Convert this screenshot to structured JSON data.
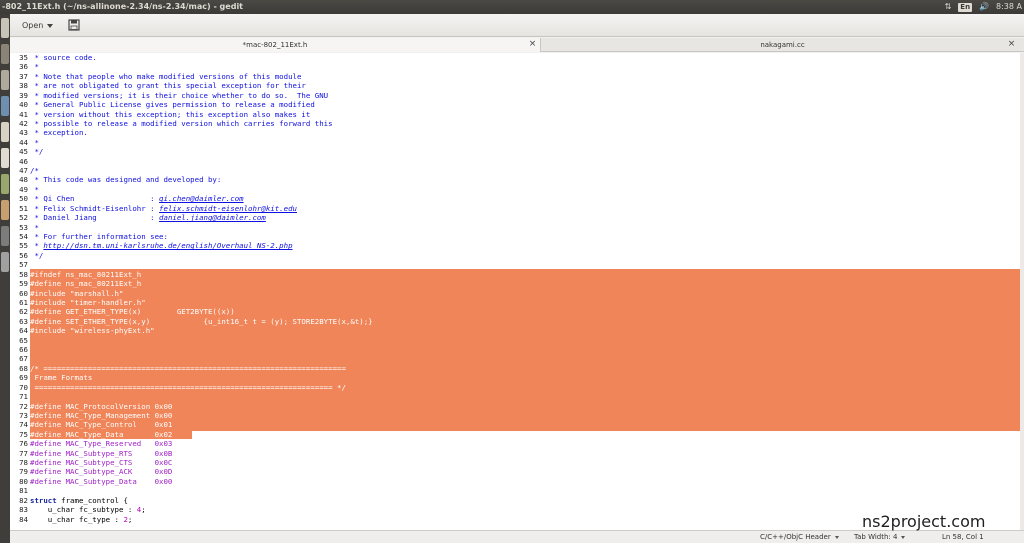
{
  "window": {
    "title": "-802_11Ext.h (~/ns-allinone-2.34/ns-2.34/mac) - gedit",
    "clock": "8:38 A",
    "keyboard_layout": "En"
  },
  "toolbar": {
    "open_label": "Open"
  },
  "tabs": [
    {
      "label": "*mac-802_11Ext.h",
      "close": "×"
    },
    {
      "label": "nakagami.cc",
      "close": "×"
    }
  ],
  "code_lines": [
    {
      "n": "35",
      "segs": [
        {
          "c": "cmt",
          "t": " * source code."
        }
      ]
    },
    {
      "n": "36",
      "segs": [
        {
          "c": "cmt",
          "t": " *"
        }
      ]
    },
    {
      "n": "37",
      "segs": [
        {
          "c": "cmt",
          "t": " * Note that people who make modified versions of this module"
        }
      ]
    },
    {
      "n": "38",
      "segs": [
        {
          "c": "cmt",
          "t": " * are not obligated to grant this special exception for their"
        }
      ]
    },
    {
      "n": "39",
      "segs": [
        {
          "c": "cmt",
          "t": " * modified versions; it is their choice whether to do so.  The GNU"
        }
      ]
    },
    {
      "n": "40",
      "segs": [
        {
          "c": "cmt",
          "t": " * General Public License gives permission to release a modified"
        }
      ]
    },
    {
      "n": "41",
      "segs": [
        {
          "c": "cmt",
          "t": " * version without this exception; this exception also makes it"
        }
      ]
    },
    {
      "n": "42",
      "segs": [
        {
          "c": "cmt",
          "t": " * possible to release a modified version which carries forward this"
        }
      ]
    },
    {
      "n": "43",
      "segs": [
        {
          "c": "cmt",
          "t": " * exception."
        }
      ]
    },
    {
      "n": "44",
      "segs": [
        {
          "c": "cmt",
          "t": " *"
        }
      ]
    },
    {
      "n": "45",
      "segs": [
        {
          "c": "cmt",
          "t": " */"
        }
      ]
    },
    {
      "n": "46",
      "segs": []
    },
    {
      "n": "47",
      "segs": [
        {
          "c": "cmt",
          "t": "/*"
        }
      ]
    },
    {
      "n": "48",
      "segs": [
        {
          "c": "cmt",
          "t": " * This code was designed and developed by:"
        }
      ]
    },
    {
      "n": "49",
      "segs": [
        {
          "c": "cmt",
          "t": " *"
        }
      ]
    },
    {
      "n": "50",
      "segs": [
        {
          "c": "cmt",
          "t": " * Qi Chen                 : "
        },
        {
          "c": "lnk",
          "t": "qi.chen@daimler.com"
        }
      ]
    },
    {
      "n": "51",
      "segs": [
        {
          "c": "cmt",
          "t": " * Felix Schmidt-Eisenlohr : "
        },
        {
          "c": "lnk",
          "t": "felix.schmidt-eisenlohr@kit.edu"
        }
      ]
    },
    {
      "n": "52",
      "segs": [
        {
          "c": "cmt",
          "t": " * Daniel Jiang            : "
        },
        {
          "c": "lnk",
          "t": "daniel.jiang@daimler.com"
        }
      ]
    },
    {
      "n": "53",
      "segs": [
        {
          "c": "cmt",
          "t": " *"
        }
      ]
    },
    {
      "n": "54",
      "segs": [
        {
          "c": "cmt",
          "t": " * For further information see:"
        }
      ]
    },
    {
      "n": "55",
      "segs": [
        {
          "c": "cmt",
          "t": " * "
        },
        {
          "c": "lnk",
          "t": "http://dsn.tm.uni-karlsruhe.de/english/Overhaul_NS-2.php"
        }
      ]
    },
    {
      "n": "56",
      "segs": [
        {
          "c": "cmt",
          "t": " */"
        }
      ]
    },
    {
      "n": "57",
      "segs": []
    },
    {
      "n": "58",
      "segs": [
        {
          "c": "pp sel",
          "t": "#ifndef ns_mac_80211Ext_h"
        }
      ]
    },
    {
      "n": "59",
      "segs": [
        {
          "c": "pp sel",
          "t": "#define ns_mac_80211Ext_h"
        }
      ]
    },
    {
      "n": "60",
      "segs": [
        {
          "c": "pp sel",
          "t": "#include \"marshall.h\""
        }
      ]
    },
    {
      "n": "61",
      "segs": [
        {
          "c": "pp sel",
          "t": "#include \"timer-handler.h\""
        }
      ]
    },
    {
      "n": "62",
      "segs": [
        {
          "c": "pp sel",
          "t": "#define GET_ETHER_TYPE(x)        GET2BYTE((x))"
        }
      ]
    },
    {
      "n": "63",
      "segs": [
        {
          "c": "pp sel",
          "t": "#define SET_ETHER_TYPE(x,y)            {u_int16_t t = (y); STORE2BYTE(x,&t);}"
        }
      ]
    },
    {
      "n": "64",
      "segs": [
        {
          "c": "pp sel",
          "t": "#include \"wireless-phyExt.h\""
        }
      ]
    },
    {
      "n": "65",
      "segs": []
    },
    {
      "n": "66",
      "segs": []
    },
    {
      "n": "67",
      "segs": []
    },
    {
      "n": "68",
      "segs": [
        {
          "c": "pp sel",
          "t": "/* ===================================================================="
        }
      ]
    },
    {
      "n": "69",
      "segs": [
        {
          "c": "pp sel",
          "t": " Frame Formats"
        }
      ]
    },
    {
      "n": "70",
      "segs": [
        {
          "c": "pp sel",
          "t": " =================================================================== */"
        }
      ]
    },
    {
      "n": "71",
      "segs": []
    },
    {
      "n": "72",
      "segs": [
        {
          "c": "pp sel",
          "t": "#define MAC_ProtocolVersion 0x00"
        }
      ]
    },
    {
      "n": "73",
      "segs": [
        {
          "c": "pp sel",
          "t": "#define MAC_Type_Management 0x00"
        }
      ]
    },
    {
      "n": "74",
      "segs": [
        {
          "c": "pp sel",
          "t": "#define MAC_Type_Control    0x01"
        }
      ]
    },
    {
      "n": "75",
      "segs": [
        {
          "c": "pp sel",
          "t": "#define MAC_Type_Data       0x02"
        }
      ]
    },
    {
      "n": "76",
      "segs": [
        {
          "c": "pp",
          "t": "#define MAC_Type_Reserved   0x03"
        }
      ]
    },
    {
      "n": "77",
      "segs": [
        {
          "c": "pp",
          "t": "#define MAC_Subtype_RTS     0x0B"
        }
      ]
    },
    {
      "n": "78",
      "segs": [
        {
          "c": "pp",
          "t": "#define MAC_Subtype_CTS     0x0C"
        }
      ]
    },
    {
      "n": "79",
      "segs": [
        {
          "c": "pp",
          "t": "#define MAC_Subtype_ACK     0x0D"
        }
      ]
    },
    {
      "n": "80",
      "segs": [
        {
          "c": "pp",
          "t": "#define MAC_Subtype_Data    0x00"
        }
      ]
    },
    {
      "n": "81",
      "segs": []
    },
    {
      "n": "82",
      "segs": [
        {
          "c": "kw",
          "t": "struct"
        },
        {
          "c": "",
          "t": " frame_control {"
        }
      ]
    },
    {
      "n": "83",
      "segs": [
        {
          "c": "",
          "t": "    u_char fc_subtype : "
        },
        {
          "c": "num",
          "t": "4"
        },
        {
          "c": "",
          "t": ";"
        }
      ]
    },
    {
      "n": "84",
      "segs": [
        {
          "c": "",
          "t": "    u_char fc_type : "
        },
        {
          "c": "num",
          "t": "2"
        },
        {
          "c": "",
          "t": ";"
        }
      ]
    }
  ],
  "statusbar": {
    "language": "C/C++/ObjC Header",
    "tab_width": "Tab Width: 4",
    "position": "Ln 58, Col 1"
  },
  "watermark": "ns2project.com",
  "colors": {
    "selection": "#f08559",
    "comment": "#1010e0",
    "preprocessor": "#a020c8",
    "keyword": "#1a2ba0"
  }
}
